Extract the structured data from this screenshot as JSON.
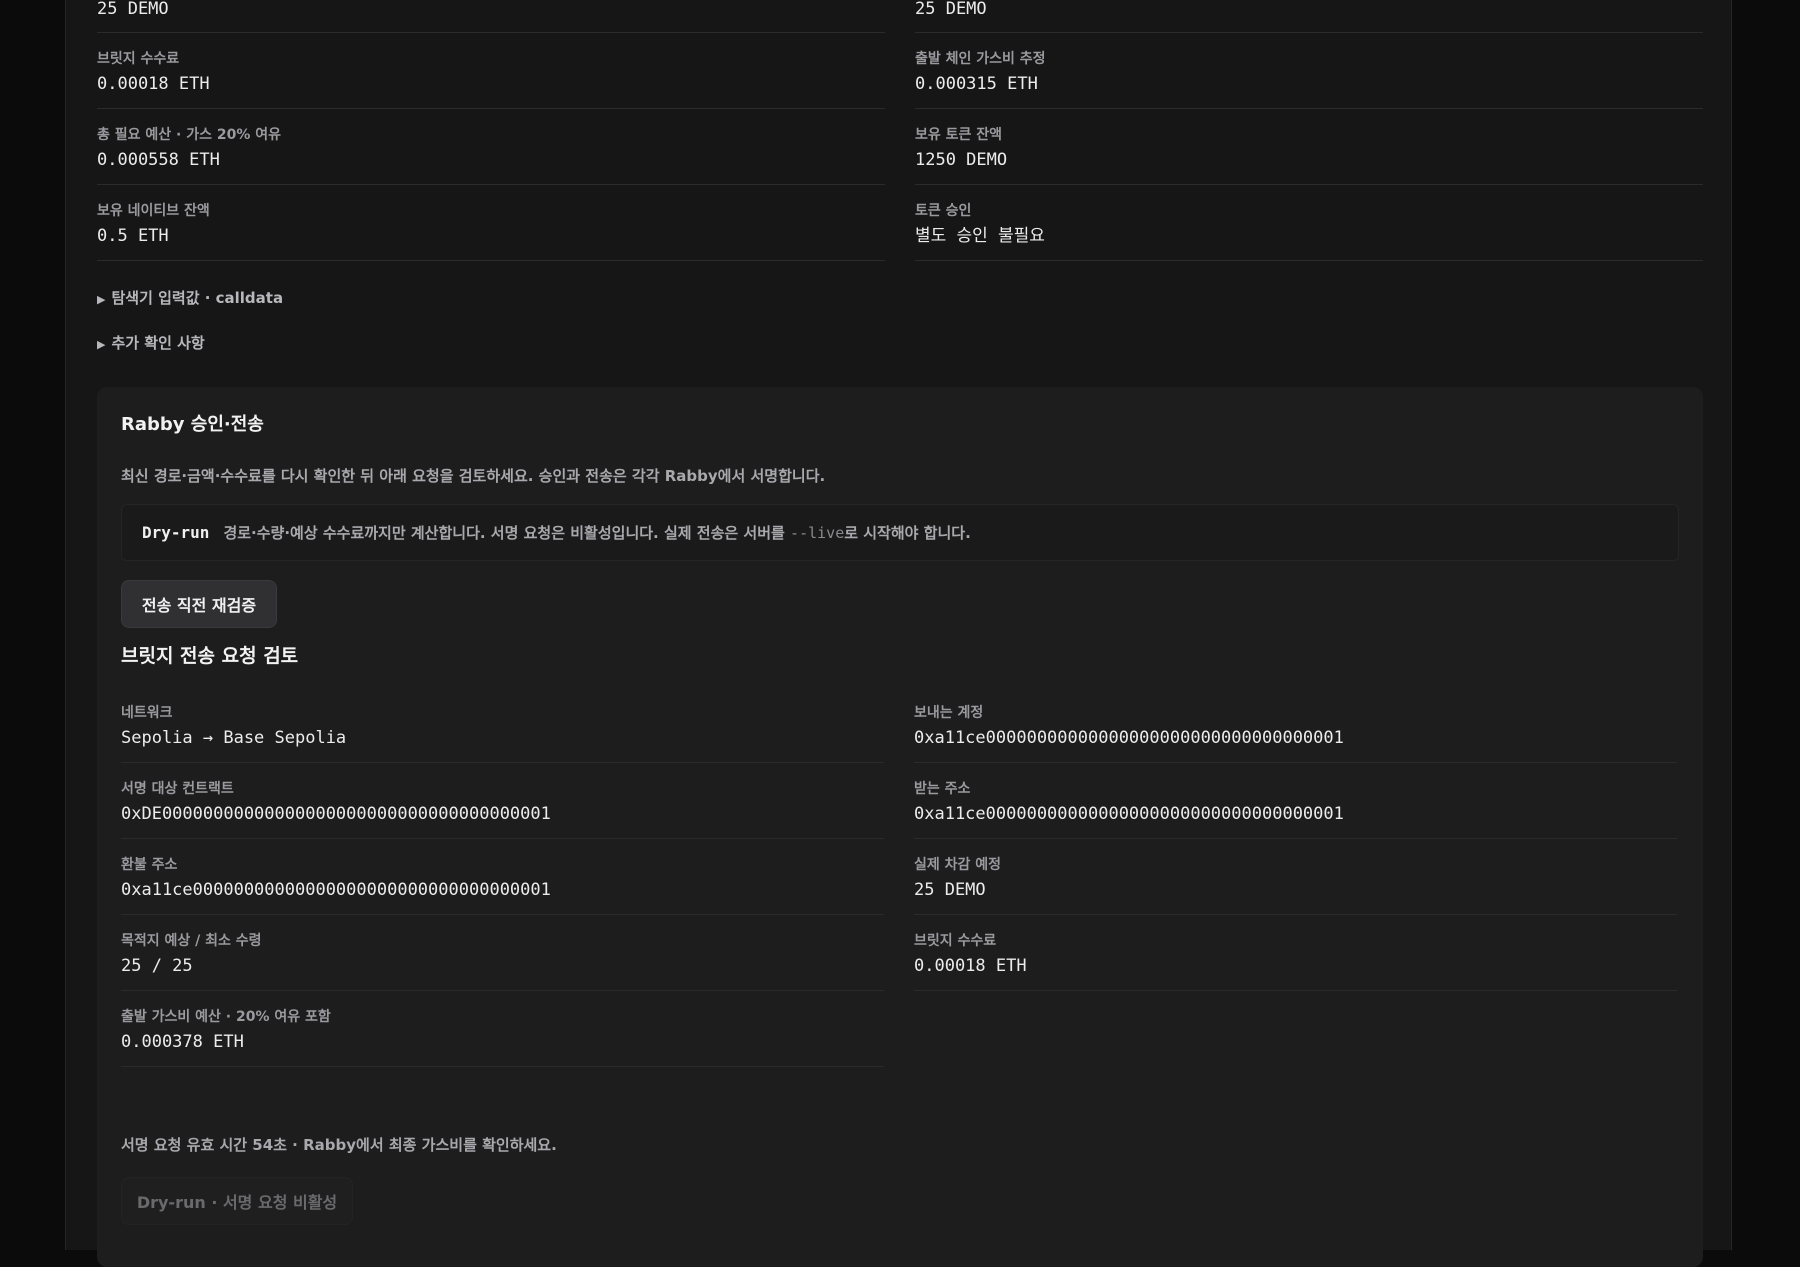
{
  "top_fields": [
    {
      "label": "",
      "value": "25 DEMO"
    },
    {
      "label": "",
      "value": "25 DEMO"
    },
    {
      "label": "브릿지 수수료",
      "value": "0.00018 ETH"
    },
    {
      "label": "출발 체인 가스비 추정",
      "value": "0.000315 ETH"
    },
    {
      "label": "총 필요 예산 · 가스 20% 여유",
      "value": "0.000558 ETH"
    },
    {
      "label": "보유 토큰 잔액",
      "value": "1250 DEMO"
    },
    {
      "label": "보유 네이티브 잔액",
      "value": "0.5 ETH"
    },
    {
      "label": "토큰 승인",
      "value": "별도 승인 불필요"
    }
  ],
  "disclosures": {
    "calldata": "탐색기 입력값 · calldata",
    "extra_checks": "추가 확인 사항"
  },
  "rabby": {
    "title": "Rabby 승인·전송",
    "description": "최신 경로·금액·수수료를 다시 확인한 뒤 아래 요청을 검토하세요. 승인과 전송은 각각 Rabby에서 서명합니다.",
    "notice_tag": "Dry-run",
    "notice_text_before": "경로·수량·예상 수수료까지만 계산합니다. 서명 요청은 비활성입니다. 실제 전송은 서버를 ",
    "notice_code": "--live",
    "notice_text_after": "로 시작해야 합니다.",
    "recheck_button": "전송 직전 재검증",
    "review_title": "브릿지 전송 요청 검토",
    "review_fields": [
      {
        "label": "네트워크",
        "value": "Sepolia → Base Sepolia"
      },
      {
        "label": "보내는 계정",
        "value": "0xa11ce00000000000000000000000000000000001"
      },
      {
        "label": "서명 대상 컨트랙트",
        "value": "0xDE00000000000000000000000000000000000001"
      },
      {
        "label": "받는 주소",
        "value": "0xa11ce00000000000000000000000000000000001"
      },
      {
        "label": "환불 주소",
        "value": "0xa11ce00000000000000000000000000000000001"
      },
      {
        "label": "실제 차감 예정",
        "value": "25 DEMO"
      },
      {
        "label": "목적지 예상 / 최소 수령",
        "value": "25 / 25"
      },
      {
        "label": "브릿지 수수료",
        "value": "0.00018 ETH"
      },
      {
        "label": "출발 가스비 예산 · 20% 여유 포함",
        "value": "0.000378 ETH"
      }
    ],
    "footnote": "서명 요청 유효 시간 54초 · Rabby에서 최종 가스비를 확인하세요.",
    "sign_button": "Dry-run · 서명 요청 비활성"
  }
}
